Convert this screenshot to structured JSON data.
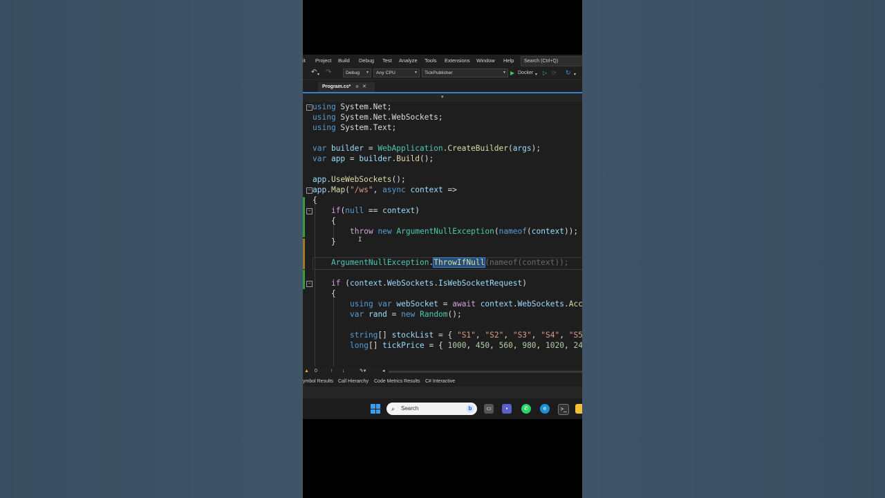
{
  "menu": {
    "items": [
      "it",
      "Project",
      "Build",
      "Debug",
      "Test",
      "Analyze",
      "Tools",
      "Extensions",
      "Window",
      "Help"
    ],
    "search": "Search (Ctrl+Q)"
  },
  "toolbar": {
    "configuration": "Debug",
    "platform": "Any CPU",
    "startup_project": "TickPublisher",
    "run_target": "Docker"
  },
  "tab": {
    "title": "Program.cs*",
    "pin": "⊕",
    "close": "✕"
  },
  "code": {
    "l1": [
      "using",
      " System.Net;"
    ],
    "l2": [
      "using",
      " System.Net.WebSockets;"
    ],
    "l3": [
      "using",
      " System.Text;"
    ],
    "l5": [
      "var",
      " builder",
      " = ",
      "WebApplication",
      ".",
      "CreateBuilder",
      "(",
      "args",
      ");"
    ],
    "l6": [
      "var",
      " app",
      " = ",
      "builder",
      ".",
      "Build",
      "();"
    ],
    "l8": [
      "app",
      ".",
      "UseWebSockets",
      "();"
    ],
    "l9": [
      "app",
      ".",
      "Map",
      "(",
      "\"/ws\"",
      ", ",
      "async",
      " ",
      "context",
      " =>"
    ],
    "l10": "{",
    "l11": [
      "if",
      "(",
      "null",
      " == ",
      "context",
      ")"
    ],
    "l12": "{",
    "l13": [
      "throw",
      " ",
      "new",
      " ",
      "ArgumentNullException",
      "(",
      "nameof",
      "(",
      "context",
      "));"
    ],
    "l14": "}",
    "l16": [
      "ArgumentNullException",
      ".",
      "ThrowIfNull",
      "(nameof(context));"
    ],
    "l18": [
      "if",
      " (",
      "context",
      ".",
      "WebSockets",
      ".",
      "IsWebSocketRequest",
      ")"
    ],
    "l19": "{",
    "l20": [
      "using",
      " ",
      "var",
      " ",
      "webSocket",
      " = ",
      "await",
      " ",
      "context",
      ".",
      "WebSockets",
      ".",
      "Acc"
    ],
    "l21": [
      "var",
      " ",
      "rand",
      " = ",
      "new",
      " ",
      "Random",
      "();"
    ],
    "l23": [
      "string",
      "[] ",
      "stockList",
      " = { ",
      "\"S1\"",
      ", ",
      "\"S2\"",
      ", ",
      "\"S3\"",
      ", ",
      "\"S4\"",
      ", ",
      "\"S5"
    ],
    "l24": [
      "long",
      "[] ",
      "tickPrice",
      " = { ",
      "1000",
      ", ",
      "450",
      ", ",
      "560",
      ", ",
      "980",
      ", ",
      "1020",
      ", ",
      "24"
    ]
  },
  "status": {
    "errors": "0"
  },
  "panel_tabs": [
    "ymbol Results",
    "Call Hierarchy",
    "Code Metrics Results",
    "C# Interactive"
  ],
  "taskbar": {
    "search": "Search"
  },
  "colors": {
    "accent": "#3d7fd1",
    "keyword": "#569cd6",
    "type": "#4ec9b0",
    "method": "#dcdcaa",
    "variable": "#9cdcfe",
    "string": "#d69d85",
    "number": "#b5cea8",
    "control": "#d8a0df"
  }
}
